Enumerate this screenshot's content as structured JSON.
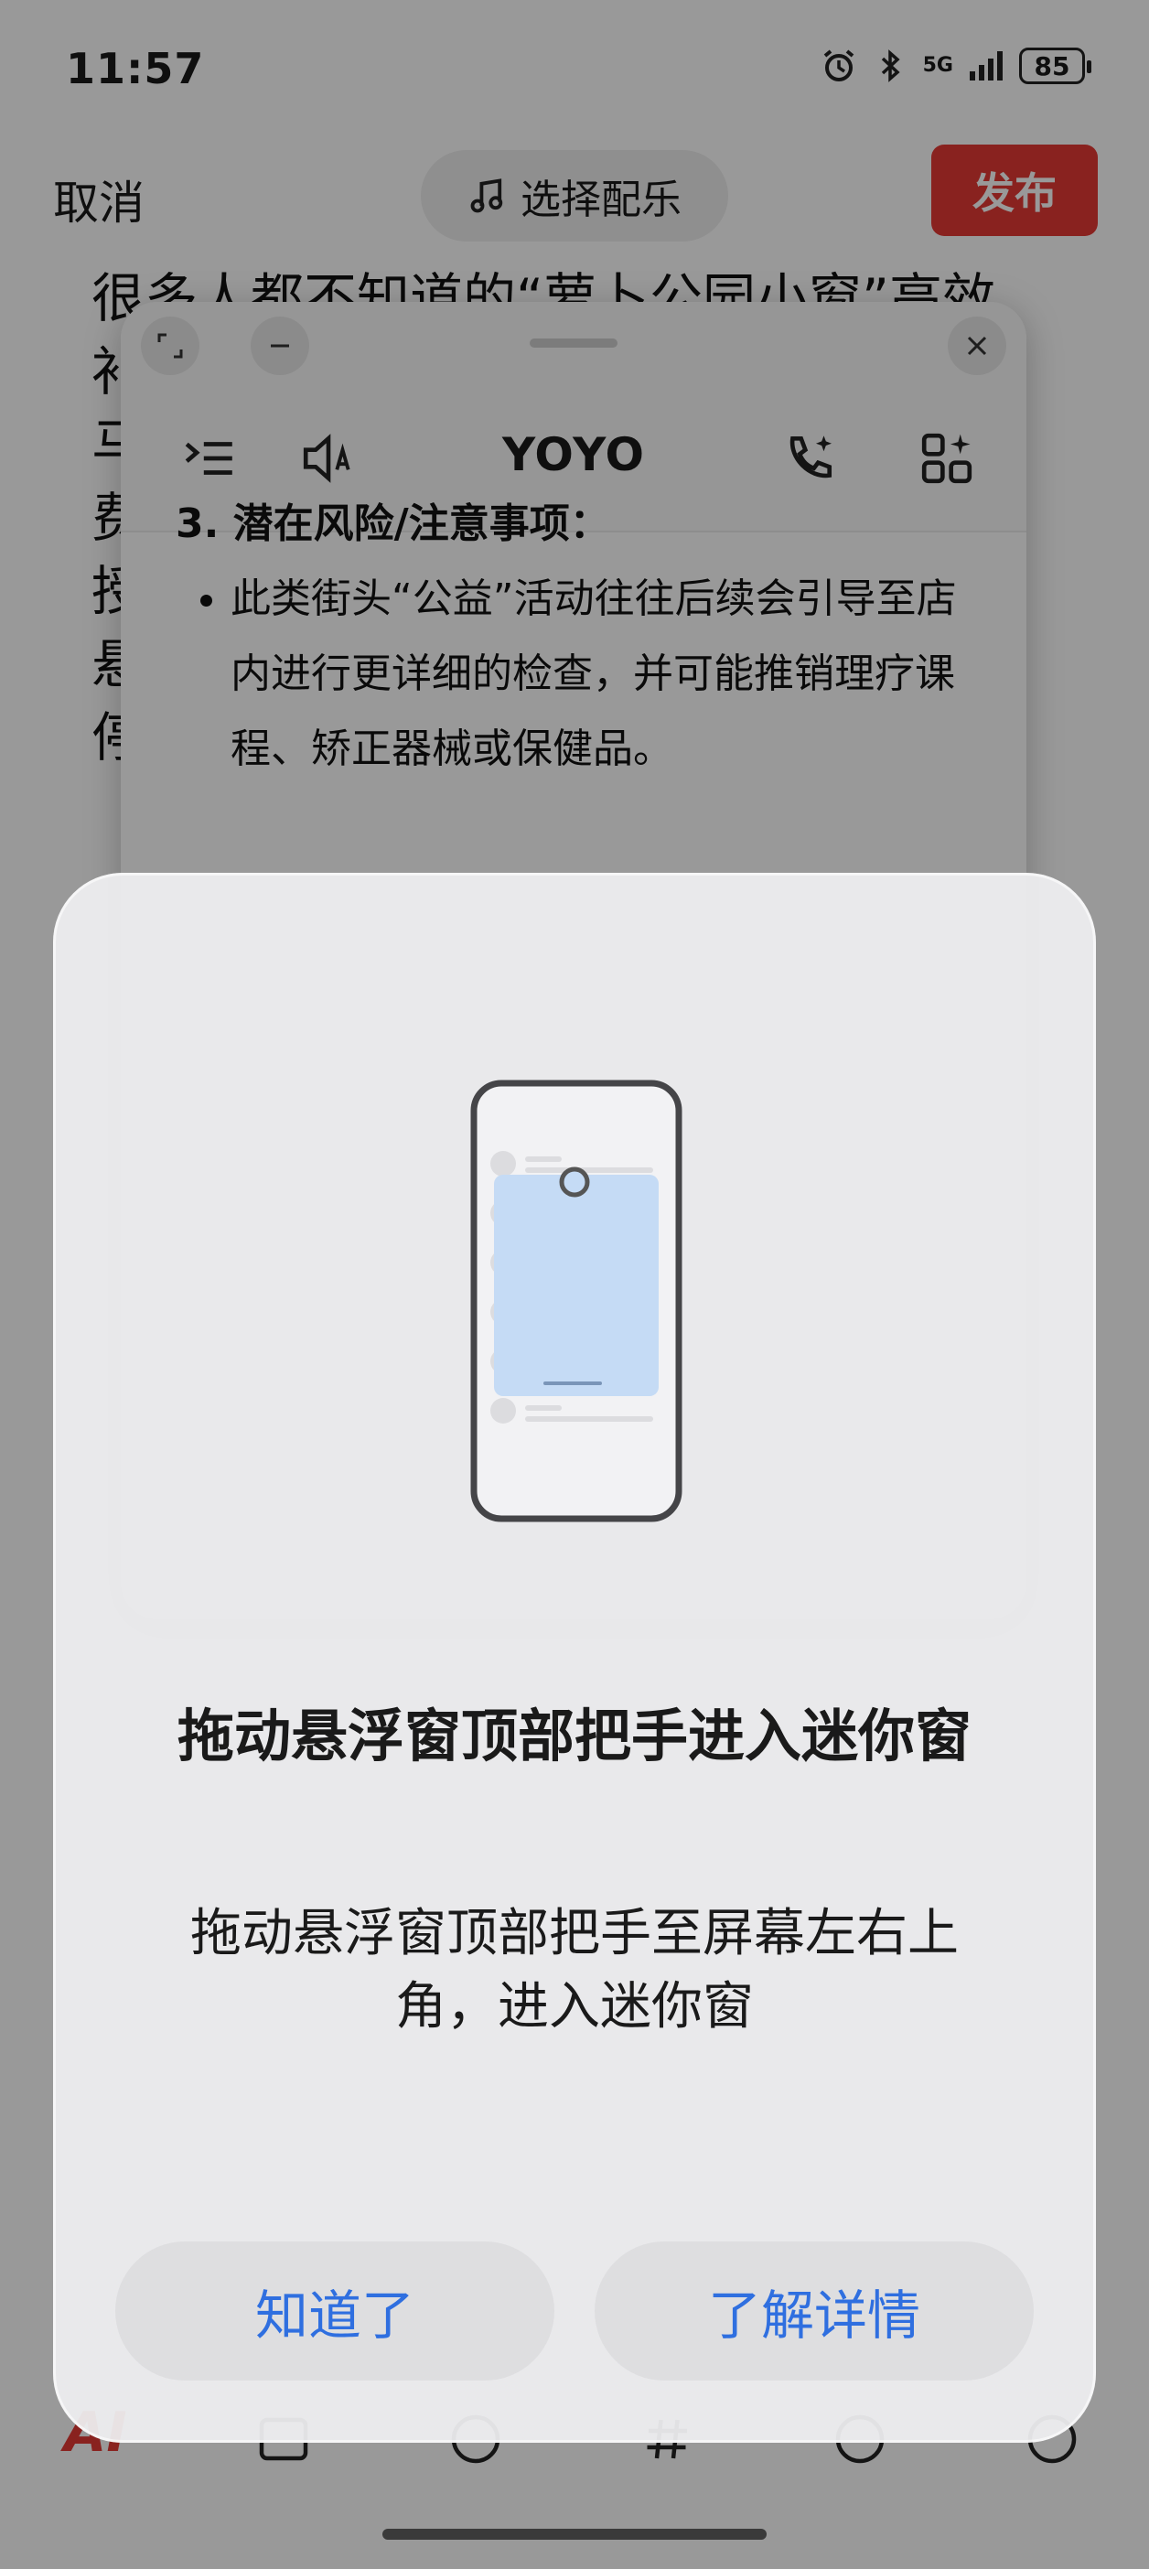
{
  "status_bar": {
    "time": "11:57",
    "network": "5G",
    "battery": "85"
  },
  "top_bar": {
    "cancel_label": "取消",
    "music_label": "选择配乐",
    "publish_label": "发布"
  },
  "article": {
    "lines": [
      "很多人都不知道的“萝卜公园小窗”高效",
      "补",
      "马",
      "费",
      "授",
      "悬",
      "停"
    ]
  },
  "floating_window": {
    "title": "YOYO",
    "section_heading": "3. 潜在风险/注意事项：",
    "bullets": [
      "此类街头“公益”活动往往后续会引导至店内进行更详细的检查，并可能推销理疗课程、矫正器械或保健品。"
    ]
  },
  "bottom_toolbar": {
    "ai_label": "AI"
  },
  "dialog": {
    "title": "拖动悬浮窗顶部把手进入迷你窗",
    "description": "拖动悬浮窗顶部把手至屏幕左右上角，进入迷你窗",
    "ok_label": "知道了",
    "more_label": "了解详情"
  },
  "colors": {
    "accent_blue": "#2f6fe0",
    "publish_red": "#e53935",
    "illustration_window": "#c5dbf5"
  }
}
